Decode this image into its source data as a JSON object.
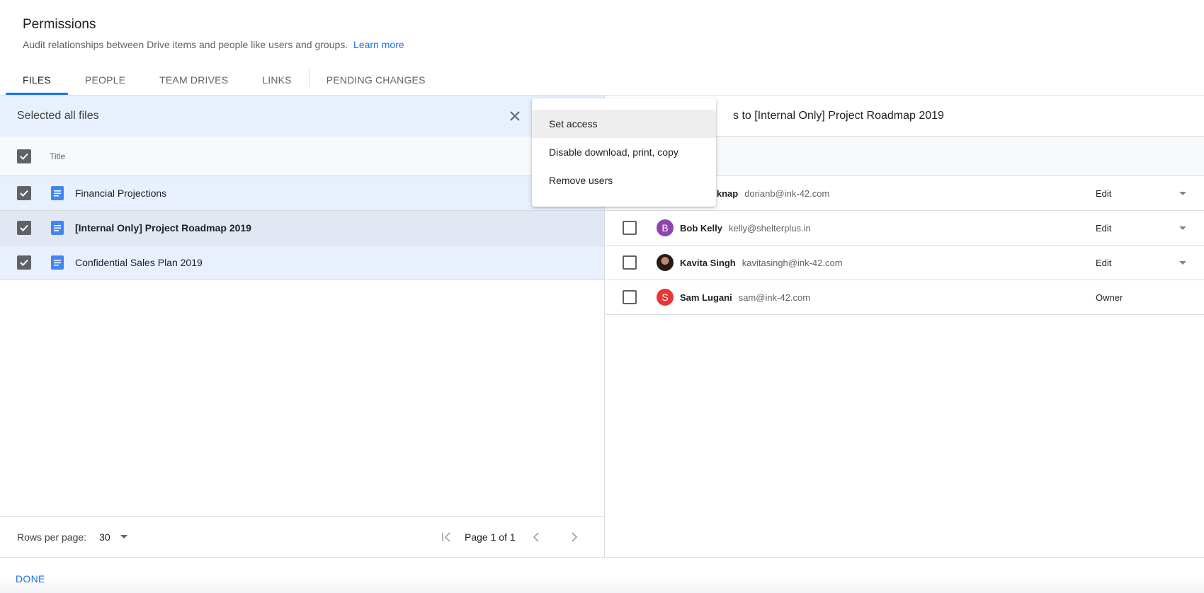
{
  "header": {
    "title": "Permissions",
    "subtitle": "Audit relationships between Drive items and people like users and groups.",
    "learn_more": "Learn more"
  },
  "tabs": [
    {
      "label": "FILES",
      "active": true
    },
    {
      "label": "PEOPLE",
      "active": false
    },
    {
      "label": "TEAM DRIVES",
      "active": false
    },
    {
      "label": "LINKS",
      "active": false
    },
    {
      "label": "PENDING CHANGES",
      "active": false
    }
  ],
  "left": {
    "selection_text": "Selected all files",
    "column_title": "Title",
    "files": [
      {
        "name": "Financial Projections",
        "checked": true,
        "icon": "docs-icon"
      },
      {
        "name": "[Internal Only] Project Roadmap 2019",
        "checked": true,
        "icon": "docs-icon"
      },
      {
        "name": "Confidential Sales Plan 2019",
        "checked": true,
        "icon": "docs-icon"
      }
    ],
    "footer": {
      "rows_per_page_label": "Rows per page:",
      "rows_per_page_value": "30",
      "page_text": "Page 1 of 1"
    }
  },
  "right": {
    "heading": "s to [Internal Only] Project Roadmap 2019",
    "people": [
      {
        "name": "elknap",
        "email": "dorianb@ink-42.com",
        "role": "Edit",
        "avatar_letter": "",
        "avatar_color": "#ffffff",
        "has_dropdown": true
      },
      {
        "name": "Bob Kelly",
        "email": "kelly@shelterplus.in",
        "role": "Edit",
        "avatar_letter": "B",
        "avatar_color": "#8e44ad",
        "has_dropdown": true
      },
      {
        "name": "Kavita Singh",
        "email": "kavitasingh@ink-42.com",
        "role": "Edit",
        "avatar_letter": "",
        "avatar_color": "#3b2a24",
        "has_dropdown": true
      },
      {
        "name": "Sam Lugani",
        "email": "sam@ink-42.com",
        "role": "Owner",
        "avatar_letter": "S",
        "avatar_color": "#e53935",
        "has_dropdown": false
      }
    ]
  },
  "menu": {
    "items": [
      "Set access",
      "Disable download, print, copy",
      "Remove users"
    ]
  },
  "bottom": {
    "done_label": "DONE"
  },
  "colors": {
    "accent": "#1a73e8",
    "selection_bg": "#e8f0fe"
  }
}
